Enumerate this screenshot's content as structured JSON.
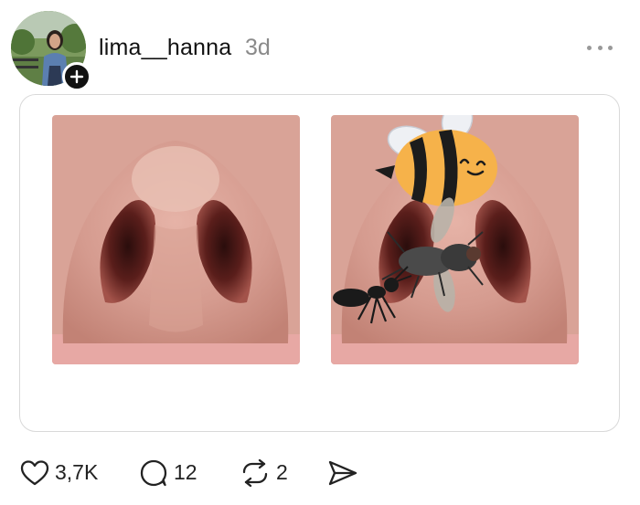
{
  "post": {
    "username": "lima__hanna",
    "time": "3d"
  },
  "actions": {
    "likes": "3,7K",
    "comments": "12",
    "reposts": "2"
  },
  "icons": {
    "follow": "plus-icon",
    "more": "more-dots-icon",
    "like": "heart-icon",
    "comment": "comment-bubble-icon",
    "repost": "repost-icon",
    "share": "send-icon"
  },
  "colors": {
    "text": "#111111",
    "muted": "#8a8a8a",
    "card_border": "#d9d9d9"
  }
}
